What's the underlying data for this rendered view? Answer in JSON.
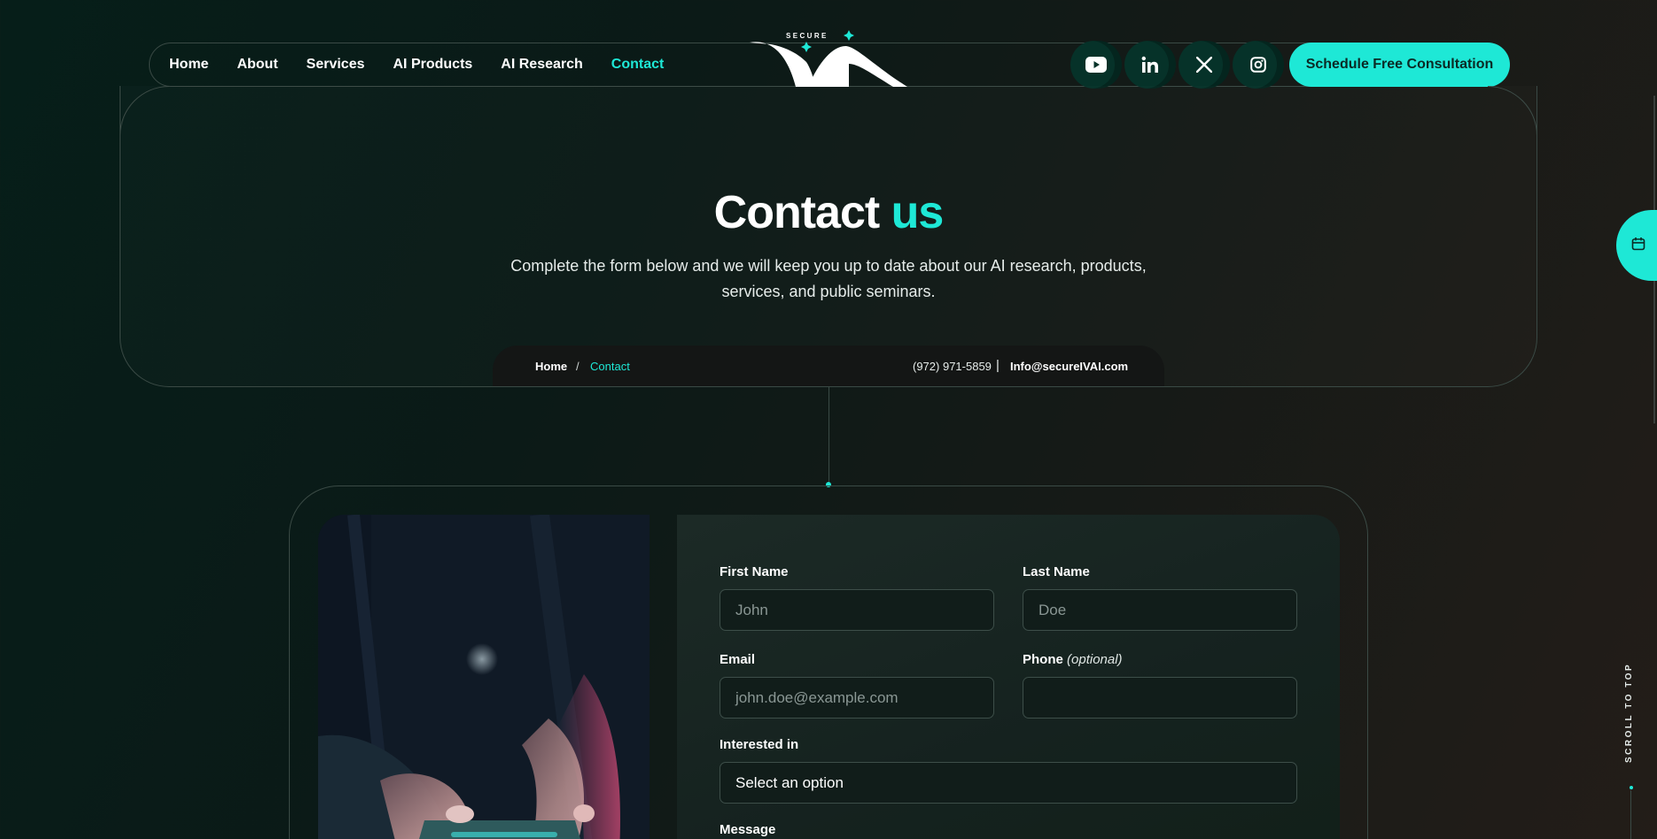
{
  "nav": {
    "items": [
      {
        "label": "Home",
        "active": false
      },
      {
        "label": "About",
        "active": false
      },
      {
        "label": "Services",
        "active": false
      },
      {
        "label": "AI Products",
        "active": false
      },
      {
        "label": "AI Research",
        "active": false
      },
      {
        "label": "Contact",
        "active": true
      }
    ],
    "logo_text": "SECURE",
    "socials": [
      "youtube-icon",
      "linkedin-icon",
      "x-icon",
      "instagram-icon"
    ],
    "cta_label": "Schedule Free Consultation"
  },
  "hero": {
    "title_main": "Contact",
    "title_accent": "us",
    "subtitle": "Complete the form below and we will keep you up to date about our AI research, products, services, and public seminars.",
    "breadcrumb": {
      "home": "Home",
      "separator": "/",
      "current": "Contact"
    },
    "phone": "(972) 971-5859",
    "pipe": "|",
    "email": "Info@secureIVAI.com"
  },
  "form": {
    "first_name": {
      "label": "First Name",
      "placeholder": "John"
    },
    "last_name": {
      "label": "Last Name",
      "placeholder": "Doe"
    },
    "email": {
      "label": "Email",
      "placeholder": "john.doe@example.com"
    },
    "phone": {
      "label": "Phone",
      "optional": "(optional)",
      "placeholder": ""
    },
    "interest": {
      "label": "Interested in",
      "selected": "Select an option"
    },
    "message": {
      "label": "Message"
    }
  },
  "side": {
    "scroll_to_top": "SCROLL TO TOP"
  },
  "colors": {
    "accent": "#1ee8d6",
    "background": "#0b1a17",
    "border": "#3a4a45"
  }
}
